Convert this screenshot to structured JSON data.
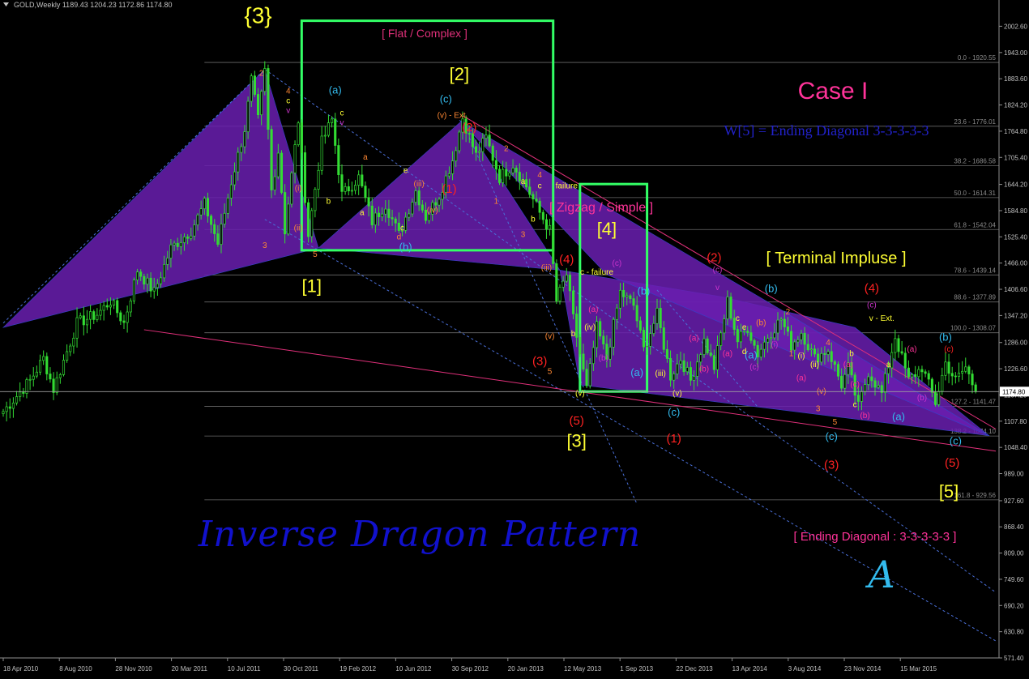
{
  "window": {
    "symbol_header": "GOLD,Weekly  1189.43 1204.23 1172.86 1174.80",
    "dropdown_icon": "triangle-down-icon"
  },
  "colors": {
    "background": "#000000",
    "candle": "#33dd33",
    "grid": "#2a2a2a",
    "price_line": "#c0c0c0",
    "triangle_fill": "#6a1fb0",
    "box": "#33ff66",
    "pink_line": "#e0307a",
    "dash_blue": "#4a6fd8",
    "yellow": "#ffff33",
    "red": "#ff2222",
    "pink": "#ff3399",
    "cyan": "#33bbee",
    "magenta": "#cc33cc",
    "orange": "#ff8833",
    "navy": "#1111cc",
    "navy_text": "#2222cc"
  },
  "chart_data": {
    "type": "candlestick",
    "title": "",
    "instrument": "GOLD",
    "timeframe": "Weekly",
    "ohlc_last": {
      "open": 1189.43,
      "high": 1204.23,
      "low": 1172.86,
      "close": 1174.8
    },
    "current_price_label": "1174.80",
    "ylim": [
      571.4,
      2040
    ],
    "y_ticks": [
      "2002.60",
      "1943.00",
      "1883.60",
      "1824.20",
      "1764.80",
      "1705.40",
      "1644.20",
      "1584.80",
      "1525.40",
      "1466.00",
      "1406.60",
      "1347.20",
      "1286.00",
      "1226.60",
      "1167.20",
      "1107.80",
      "1048.40",
      "989.00",
      "927.60",
      "868.40",
      "809.00",
      "749.60",
      "690.20",
      "630.80",
      "571.40"
    ],
    "x_ticks": [
      "18 Apr 2010",
      "8 Aug 2010",
      "28 Nov 2010",
      "20 Mar 2011",
      "10 Jul 2011",
      "30 Oct 2011",
      "19 Feb 2012",
      "10 Jun 2012",
      "30 Sep 2012",
      "20 Jan 2013",
      "12 May 2013",
      "1 Sep 2013",
      "22 Dec 2013",
      "13 Apr 2014",
      "3 Aug 2014",
      "23 Nov 2014",
      "15 Mar 2015"
    ],
    "pivots": [
      {
        "t": 0,
        "p": 1130
      },
      {
        "t": 8,
        "p": 1200
      },
      {
        "t": 12,
        "p": 1250
      },
      {
        "t": 15,
        "p": 1180
      },
      {
        "t": 22,
        "p": 1330
      },
      {
        "t": 28,
        "p": 1350
      },
      {
        "t": 32,
        "p": 1380
      },
      {
        "t": 36,
        "p": 1330
      },
      {
        "t": 40,
        "p": 1450
      },
      {
        "t": 45,
        "p": 1400
      },
      {
        "t": 50,
        "p": 1500
      },
      {
        "t": 56,
        "p": 1540
      },
      {
        "t": 60,
        "p": 1600
      },
      {
        "t": 64,
        "p": 1510
      },
      {
        "t": 68,
        "p": 1650
      },
      {
        "t": 72,
        "p": 1770
      },
      {
        "t": 74,
        "p": 1880
      },
      {
        "t": 76,
        "p": 1790
      },
      {
        "t": 78,
        "p": 1900
      },
      {
        "t": 80,
        "p": 1630
      },
      {
        "t": 82,
        "p": 1720
      },
      {
        "t": 84,
        "p": 1540
      },
      {
        "t": 88,
        "p": 1790
      },
      {
        "t": 91,
        "p": 1530
      },
      {
        "t": 95,
        "p": 1740
      },
      {
        "t": 98,
        "p": 1790
      },
      {
        "t": 101,
        "p": 1620
      },
      {
        "t": 106,
        "p": 1660
      },
      {
        "t": 110,
        "p": 1560
      },
      {
        "t": 114,
        "p": 1600
      },
      {
        "t": 118,
        "p": 1530
      },
      {
        "t": 123,
        "p": 1630
      },
      {
        "t": 126,
        "p": 1570
      },
      {
        "t": 130,
        "p": 1620
      },
      {
        "t": 134,
        "p": 1700
      },
      {
        "t": 137,
        "p": 1795
      },
      {
        "t": 141,
        "p": 1710
      },
      {
        "t": 144,
        "p": 1750
      },
      {
        "t": 148,
        "p": 1660
      },
      {
        "t": 152,
        "p": 1690
      },
      {
        "t": 156,
        "p": 1640
      },
      {
        "t": 160,
        "p": 1580
      },
      {
        "t": 163,
        "p": 1540
      },
      {
        "t": 165,
        "p": 1380
      },
      {
        "t": 168,
        "p": 1440
      },
      {
        "t": 170,
        "p": 1340
      },
      {
        "t": 172,
        "p": 1260
      },
      {
        "t": 174,
        "p": 1180
      },
      {
        "t": 177,
        "p": 1320
      },
      {
        "t": 180,
        "p": 1250
      },
      {
        "t": 184,
        "p": 1400
      },
      {
        "t": 188,
        "p": 1370
      },
      {
        "t": 191,
        "p": 1270
      },
      {
        "t": 195,
        "p": 1350
      },
      {
        "t": 199,
        "p": 1210
      },
      {
        "t": 202,
        "p": 1250
      },
      {
        "t": 205,
        "p": 1200
      },
      {
        "t": 209,
        "p": 1290
      },
      {
        "t": 212,
        "p": 1230
      },
      {
        "t": 216,
        "p": 1380
      },
      {
        "t": 219,
        "p": 1290
      },
      {
        "t": 222,
        "p": 1320
      },
      {
        "t": 225,
        "p": 1260
      },
      {
        "t": 228,
        "p": 1300
      },
      {
        "t": 232,
        "p": 1340
      },
      {
        "t": 235,
        "p": 1280
      },
      {
        "t": 238,
        "p": 1310
      },
      {
        "t": 242,
        "p": 1250
      },
      {
        "t": 246,
        "p": 1270
      },
      {
        "t": 250,
        "p": 1190
      },
      {
        "t": 252,
        "p": 1230
      },
      {
        "t": 255,
        "p": 1140
      },
      {
        "t": 258,
        "p": 1220
      },
      {
        "t": 262,
        "p": 1170
      },
      {
        "t": 266,
        "p": 1300
      },
      {
        "t": 270,
        "p": 1200
      },
      {
        "t": 274,
        "p": 1230
      },
      {
        "t": 278,
        "p": 1150
      },
      {
        "t": 281,
        "p": 1240
      },
      {
        "t": 284,
        "p": 1200
      },
      {
        "t": 287,
        "p": 1230
      },
      {
        "t": 290,
        "p": 1175
      }
    ],
    "fib_levels": [
      {
        "label": "0.0 - 1920.55",
        "value": 1920.55
      },
      {
        "label": "23.6 - 1776.01",
        "value": 1776.01
      },
      {
        "label": "38.2 - 1686.58",
        "value": 1686.58
      },
      {
        "label": "50.0 - 1614.31",
        "value": 1614.31
      },
      {
        "label": "61.8 - 1542.04",
        "value": 1542.04
      },
      {
        "label": "78.6 - 1439.14",
        "value": 1439.14
      },
      {
        "label": "88.6 - 1377.89",
        "value": 1377.89
      },
      {
        "label": "100.0 - 1308.07",
        "value": 1308.07
      },
      {
        "label": "127.2 - 1141.47",
        "value": 1141.47
      },
      {
        "label": "138.2 - 1074.10",
        "value": 1074.1
      },
      {
        "label": "161.8 - 929.56",
        "value": 929.56
      }
    ],
    "annotations": {
      "title_case": "Case I",
      "ending_diagonal_note": "W[5] = Ending Diagonal 3-3-3-3-3",
      "flat_complex": "[ Flat / Complex ]",
      "zigzag_simple": "[ Zigzag / Simple ]",
      "terminal_impulse": "[ Terminal Impluse ]",
      "ending_diagonal_bottom": "[ Ending Diagonal : 3-3-3-3-3 ]",
      "pattern_name": "Inverse Dragon Pattern",
      "script_a": "A"
    },
    "major_waves": [
      {
        "label": "{3}",
        "t": 76,
        "p": 2010
      },
      {
        "label": "[1]",
        "t": 92,
        "p": 1400
      },
      {
        "label": "[2]",
        "t": 136,
        "p": 1880
      },
      {
        "label": "[3]",
        "t": 171,
        "p": 1050
      },
      {
        "label": "[4]",
        "t": 180,
        "p": 1530
      },
      {
        "label": "[5]",
        "t": 282,
        "p": 935
      }
    ],
    "red_waves": [
      {
        "label": "(2)",
        "t": 139,
        "p": 1765
      },
      {
        "label": "(1)",
        "t": 133,
        "p": 1625
      },
      {
        "label": "(4)",
        "t": 168,
        "p": 1465
      },
      {
        "label": "(3)",
        "t": 160,
        "p": 1235
      },
      {
        "label": "(5)",
        "t": 171,
        "p": 1100
      },
      {
        "label": "(2)",
        "t": 212,
        "p": 1470
      },
      {
        "label": "(1)",
        "t": 200,
        "p": 1060
      },
      {
        "label": "(4)",
        "t": 259,
        "p": 1400
      },
      {
        "label": "(3)",
        "t": 247,
        "p": 1000
      },
      {
        "label": "(5)",
        "t": 283,
        "p": 1005
      }
    ],
    "cyan_waves": [
      {
        "label": "(a)",
        "t": 99,
        "p": 1850
      },
      {
        "label": "(c)",
        "t": 132,
        "p": 1830
      },
      {
        "label": "(b)",
        "t": 120,
        "p": 1495
      },
      {
        "label": "(b)",
        "t": 191,
        "p": 1395
      },
      {
        "label": "(a)",
        "t": 189,
        "p": 1210
      },
      {
        "label": "(c)",
        "t": 200,
        "p": 1120
      },
      {
        "label": "(b)",
        "t": 229,
        "p": 1400
      },
      {
        "label": "(a)",
        "t": 223,
        "p": 1250
      },
      {
        "label": "(c)",
        "t": 247,
        "p": 1065
      },
      {
        "label": "(a)",
        "t": 267,
        "p": 1110
      },
      {
        "label": "(b)",
        "t": 281,
        "p": 1290
      },
      {
        "label": "(c)",
        "t": 284,
        "p": 1055
      }
    ],
    "small_labels": [
      {
        "label": "2",
        "t": 77,
        "p": 1890,
        "c": "orange"
      },
      {
        "label": "4",
        "t": 85,
        "p": 1850,
        "c": "orange"
      },
      {
        "label": "c",
        "t": 85,
        "p": 1828,
        "c": "yellow"
      },
      {
        "label": "v",
        "t": 85,
        "p": 1806,
        "c": "magenta"
      },
      {
        "label": "3",
        "t": 78,
        "p": 1500,
        "c": "orange"
      },
      {
        "label": "5",
        "t": 93,
        "p": 1480,
        "c": "orange"
      },
      {
        "label": "c",
        "t": 101,
        "p": 1800,
        "c": "yellow"
      },
      {
        "label": "v",
        "t": 101,
        "p": 1778,
        "c": "magenta"
      },
      {
        "label": "(v) - Ext.",
        "t": 134,
        "p": 1795,
        "c": "orange"
      },
      {
        "label": "2",
        "t": 150,
        "p": 1720,
        "c": "orange"
      },
      {
        "label": "1",
        "t": 147,
        "p": 1600,
        "c": "orange"
      },
      {
        "label": "4",
        "t": 160,
        "p": 1660,
        "c": "orange"
      },
      {
        "label": "c",
        "t": 160,
        "p": 1635,
        "c": "yellow"
      },
      {
        "label": "failure",
        "t": 168,
        "p": 1635,
        "c": "yellow"
      },
      {
        "label": "3",
        "t": 155,
        "p": 1525,
        "c": "orange"
      },
      {
        "label": "5",
        "t": 163,
        "p": 1215,
        "c": "orange"
      },
      {
        "label": "c - failure",
        "t": 177,
        "p": 1440,
        "c": "yellow"
      },
      {
        "label": "(c)",
        "t": 183,
        "p": 1460,
        "c": "magenta"
      },
      {
        "label": "(c)",
        "t": 213,
        "p": 1445,
        "c": "magenta"
      },
      {
        "label": "v",
        "t": 213,
        "p": 1405,
        "c": "magenta"
      },
      {
        "label": "2",
        "t": 234,
        "p": 1350,
        "c": "orange"
      },
      {
        "label": "4",
        "t": 246,
        "p": 1280,
        "c": "orange"
      },
      {
        "label": "(c)",
        "t": 259,
        "p": 1365,
        "c": "magenta"
      },
      {
        "label": "v - Ext.",
        "t": 262,
        "p": 1335,
        "c": "yellow"
      },
      {
        "label": "5",
        "t": 248,
        "p": 1100,
        "c": "orange"
      },
      {
        "label": "(a)",
        "t": 271,
        "p": 1265,
        "c": "pink"
      },
      {
        "label": "(c)",
        "t": 282,
        "p": 1265,
        "c": "red"
      },
      {
        "label": "(b)",
        "t": 274,
        "p": 1155,
        "c": "magenta"
      },
      {
        "label": "(i)",
        "t": 88,
        "p": 1630,
        "c": "orange"
      },
      {
        "label": "(ii)",
        "t": 88,
        "p": 1540,
        "c": "orange"
      },
      {
        "label": "(iii)",
        "t": 124,
        "p": 1640,
        "c": "orange"
      },
      {
        "label": "(iv)",
        "t": 128,
        "p": 1580,
        "c": "orange"
      },
      {
        "label": "(v)",
        "t": 163,
        "p": 1295,
        "c": "orange"
      },
      {
        "label": "(iii)",
        "t": 162,
        "p": 1450,
        "c": "orange"
      },
      {
        "label": "(iv)",
        "t": 175,
        "p": 1315,
        "c": "yellow"
      },
      {
        "label": "(a)",
        "t": 176,
        "p": 1355,
        "c": "pink"
      },
      {
        "label": "(b)",
        "t": 179,
        "p": 1245,
        "c": "magenta"
      },
      {
        "label": "(v)",
        "t": 172,
        "p": 1165,
        "c": "yellow"
      },
      {
        "label": "(iii)",
        "t": 196,
        "p": 1210,
        "c": "yellow"
      },
      {
        "label": "(v)",
        "t": 201,
        "p": 1165,
        "c": "yellow"
      },
      {
        "label": "(a)",
        "t": 206,
        "p": 1290,
        "c": "pink"
      },
      {
        "label": "(b)",
        "t": 209,
        "p": 1220,
        "c": "pink"
      },
      {
        "label": "(a)",
        "t": 216,
        "p": 1255,
        "c": "pink"
      },
      {
        "label": "(c)",
        "t": 224,
        "p": 1225,
        "c": "magenta"
      },
      {
        "label": "(b)",
        "t": 226,
        "p": 1325,
        "c": "orange"
      },
      {
        "label": "(i)",
        "t": 238,
        "p": 1250,
        "c": "yellow"
      },
      {
        "label": "(ii)",
        "t": 242,
        "p": 1230,
        "c": "yellow"
      },
      {
        "label": "(a)",
        "t": 238,
        "p": 1200,
        "c": "pink"
      },
      {
        "label": "(a)",
        "t": 252,
        "p": 1230,
        "c": "pink"
      },
      {
        "label": "(c)",
        "t": 254,
        "p": 1185,
        "c": "pink"
      },
      {
        "label": "(b)",
        "t": 257,
        "p": 1115,
        "c": "pink"
      },
      {
        "label": "(v)",
        "t": 244,
        "p": 1170,
        "c": "orange"
      },
      {
        "label": "a",
        "t": 108,
        "p": 1700,
        "c": "orange"
      },
      {
        "label": "a",
        "t": 107,
        "p": 1575,
        "c": "yellow"
      },
      {
        "label": "b",
        "t": 97,
        "p": 1600,
        "c": "yellow"
      },
      {
        "label": "d",
        "t": 118,
        "p": 1520,
        "c": "orange"
      },
      {
        "label": "e",
        "t": 120,
        "p": 1670,
        "c": "yellow"
      },
      {
        "label": "c",
        "t": 119,
        "p": 1540,
        "c": "yellow"
      },
      {
        "label": "b",
        "t": 158,
        "p": 1560,
        "c": "yellow"
      },
      {
        "label": "a",
        "t": 155,
        "p": 1645,
        "c": "yellow"
      },
      {
        "label": "b",
        "t": 170,
        "p": 1300,
        "c": "yellow"
      },
      {
        "label": "e",
        "t": 221,
        "p": 1315,
        "c": "yellow"
      },
      {
        "label": "c",
        "t": 219,
        "p": 1335,
        "c": "yellow"
      },
      {
        "label": "d",
        "t": 221,
        "p": 1260,
        "c": "yellow"
      },
      {
        "label": "b",
        "t": 253,
        "p": 1255,
        "c": "yellow"
      },
      {
        "label": "c",
        "t": 254,
        "p": 1140,
        "c": "yellow"
      },
      {
        "label": "a",
        "t": 264,
        "p": 1230,
        "c": "yellow"
      },
      {
        "label": "3",
        "t": 243,
        "p": 1130,
        "c": "orange"
      },
      {
        "label": "1",
        "t": 235,
        "p": 1255,
        "c": "orange"
      },
      {
        "label": "(i)",
        "t": 230,
        "p": 1275,
        "c": "magenta"
      }
    ]
  }
}
